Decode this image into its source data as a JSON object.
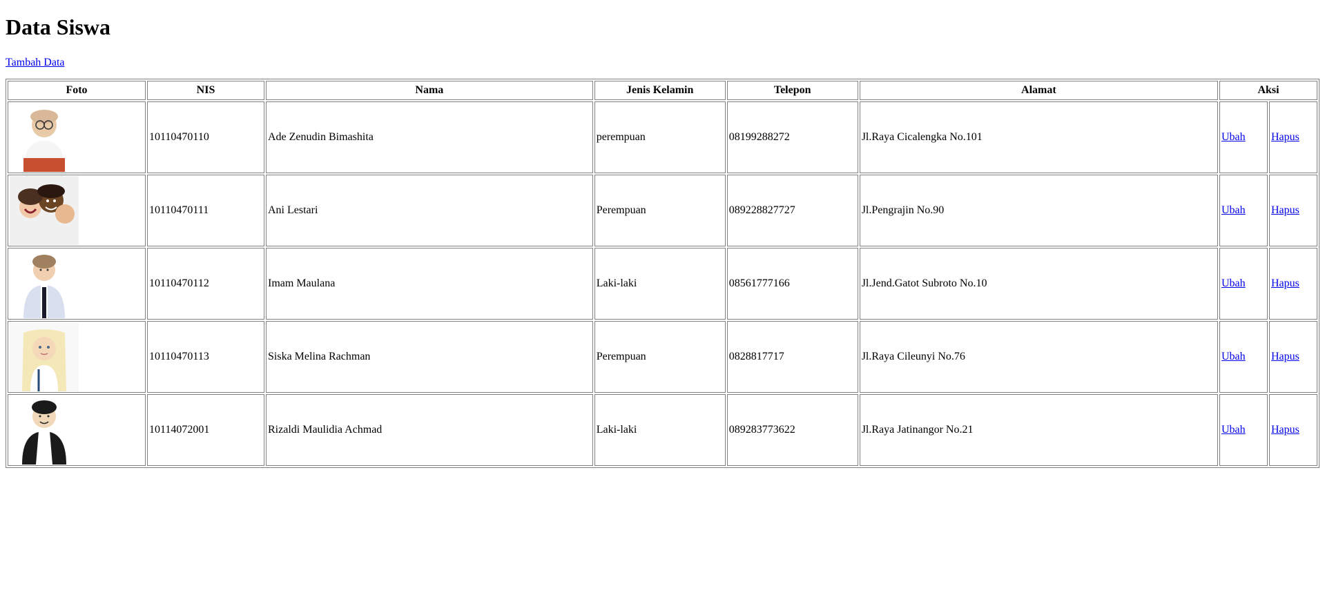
{
  "page": {
    "title": "Data Siswa",
    "add_link_label": "Tambah Data"
  },
  "table": {
    "headers": {
      "foto": "Foto",
      "nis": "NIS",
      "nama": "Nama",
      "jenis_kelamin": "Jenis Kelamin",
      "telepon": "Telepon",
      "alamat": "Alamat",
      "aksi": "Aksi"
    },
    "action_labels": {
      "edit": "Ubah",
      "delete": "Hapus"
    },
    "rows": [
      {
        "nis": "10110470110",
        "nama": "Ade Zenudin Bimashita",
        "jenis_kelamin": "perempuan",
        "telepon": "08199288272",
        "alamat": "Jl.Raya Cicalengka No.101"
      },
      {
        "nis": "10110470111",
        "nama": "Ani Lestari",
        "jenis_kelamin": "Perempuan",
        "telepon": "089228827727",
        "alamat": "Jl.Pengrajin No.90"
      },
      {
        "nis": "10110470112",
        "nama": "Imam Maulana",
        "jenis_kelamin": "Laki-laki",
        "telepon": "08561777166",
        "alamat": "Jl.Jend.Gatot Subroto No.10"
      },
      {
        "nis": "10110470113",
        "nama": "Siska Melina Rachman",
        "jenis_kelamin": "Perempuan",
        "telepon": "0828817717",
        "alamat": "Jl.Raya Cileunyi No.76"
      },
      {
        "nis": "10114072001",
        "nama": "Rizaldi Maulidia Achmad",
        "jenis_kelamin": "Laki-laki",
        "telepon": "089283773622",
        "alamat": "Jl.Raya Jatinangor No.21"
      }
    ]
  }
}
